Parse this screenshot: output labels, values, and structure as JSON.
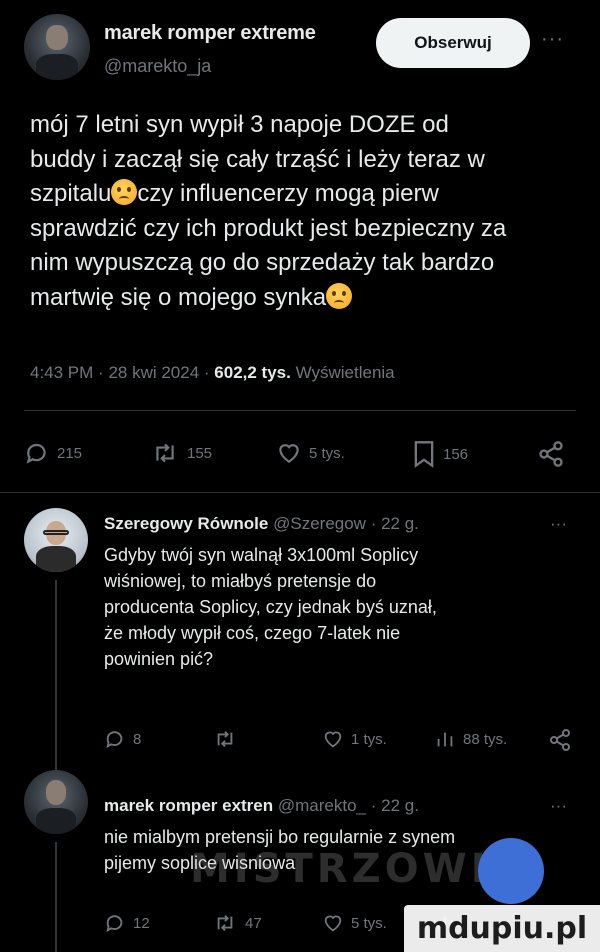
{
  "main_tweet": {
    "author_name": "marek romper extreme",
    "author_handle": "@marekto_ja",
    "follow_label": "Obserwuj",
    "more_label": "···",
    "text_lines": [
      "mój 7 letni syn wypił 3 napoje DOZE od",
      "buddy i zaczął się cały trząść i leży teraz w",
      "szpitalu",
      "czy influencerzy mogą pierw",
      "sprawdzić czy ich produkt jest bezpieczny za",
      "nim wypuszczą go do sprzedaży tak bardzo",
      "martwię się o mojego synka"
    ],
    "emoji_icons": [
      "crying-face-emoji",
      "pleading-face-emoji"
    ],
    "time": "4:43 PM",
    "date": "28 kwi 2024",
    "views_count": "602,2 tys.",
    "views_label": "Wyświetlenia",
    "actions": {
      "replies": "215",
      "reposts": "155",
      "likes": "5 tys.",
      "bookmarks": "156"
    }
  },
  "replies": [
    {
      "author_name": "Szeregowy Równole",
      "author_handle": "@Szeregow",
      "age": "· 22 g.",
      "more_label": "···",
      "text_lines": [
        "Gdyby twój syn walnął 3x100ml Soplicy",
        "wiśniowej, to miałbyś pretensje do",
        "producenta Soplicy, czy jednak byś uznał,",
        "że młody wypił coś, czego 7-latek nie",
        "powinien pić?"
      ],
      "actions": {
        "replies": "8",
        "reposts": "",
        "likes": "1 tys.",
        "views": "88 tys."
      }
    },
    {
      "author_name": "marek romper extren",
      "author_handle": "@marekto_",
      "age": "· 22 g.",
      "more_label": "···",
      "text_lines": [
        "nie mialbym pretensji bo regularnie z synem",
        "pijemy soplice wisniowa"
      ],
      "actions": {
        "replies": "12",
        "reposts": "47",
        "likes": "5 tys.",
        "views": ""
      }
    }
  ],
  "watermark": "mdupiu.pl",
  "colors": {
    "background": "#000000",
    "text": "#e7e9ea",
    "muted": "#71767b",
    "divider": "#2f3336",
    "follow_button_bg": "#eff3f4"
  }
}
